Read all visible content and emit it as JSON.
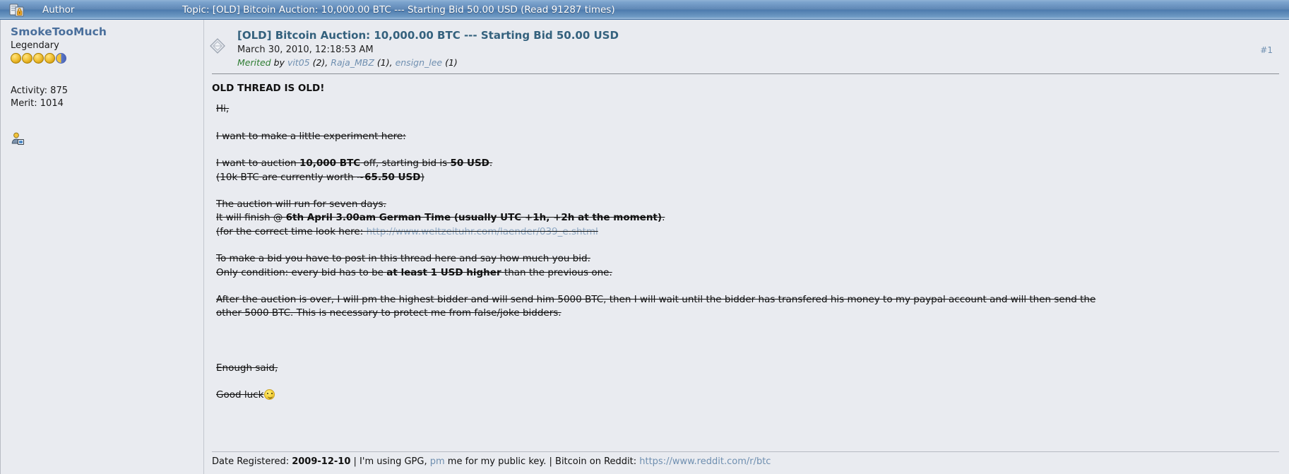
{
  "topbar": {
    "lock_icon": "locked-topic-icon",
    "author_column_label": "Author",
    "topic_label": "Topic: [OLD] Bitcoin Auction: 10,000.00 BTC --- Starting Bid 50.00 USD  (Read 91287 times)"
  },
  "poster": {
    "username": "SmokeTooMuch",
    "rank": "Legendary",
    "badge_count": 5,
    "activity": "Activity: 875",
    "merit": "Merit: 1014",
    "profile_icon": "user-profile-icon"
  },
  "post": {
    "icon": "post-xx-icon",
    "subject": "[OLD] Bitcoin Auction: 10,000.00 BTC --- Starting Bid 50.00 USD",
    "date": "March 30, 2010, 12:18:53 AM",
    "merit": {
      "merited_word": "Merited",
      "by_word": "by",
      "sources": [
        {
          "name": "vit05",
          "count": "(2)"
        },
        {
          "name": "Raja_MBZ",
          "count": "(1)"
        },
        {
          "name": "ensign_lee",
          "count": "(1)"
        }
      ],
      "separator": ", "
    },
    "post_number": "#1",
    "body": {
      "headline": "OLD THREAD IS OLD!",
      "greeting": "Hi,",
      "line_experiment": "I want to make a little experiment here:",
      "auction_pre": "I want to auction ",
      "auction_amount": "10,000 BTC",
      "auction_mid": " off, starting bid is ",
      "auction_bid": "50 USD",
      "auction_post": ".",
      "worth_pre": "(10k BTC are currently worth ~",
      "worth_value": "65.50 USD",
      "worth_post": ")",
      "run_days": "The auction will run for seven days.",
      "finish_pre": "It will finish @ ",
      "finish_bold": "6th April 3.00am German Time (usually UTC +1h, +2h at the moment)",
      "finish_post": ".",
      "timelink_pre": "(for the correct time look here: ",
      "timelink_url": "http://www.weltzeituhr.com/laender/039_e.shtml",
      "bid_howto": "To make a bid you have to post in this thread here and say how much you bid.",
      "condition_pre": "Only condition: every bid has to be ",
      "condition_bold": "at least 1 USD higher",
      "condition_post": " than the previous one.",
      "after_auction_line1": "After the auction is over, I will pm the highest bidder and will send him 5000 BTC, then I will wait until the bidder has transfered his money to my paypal account and will then send the",
      "after_auction_line2": "other 5000 BTC. This is necessary to protect me from false/joke bidders.",
      "enough_said": "Enough said,",
      "good_luck": "Good luck",
      "good_luck_smiley": "smiley-wink-icon"
    }
  },
  "signature": {
    "date_registered_label": "Date Registered: ",
    "date_registered_value": "2009-12-10",
    "sep1": " | ",
    "gpg_pre": "I'm using GPG, ",
    "pm_link": "pm",
    "gpg_post": " me for my public key.",
    "sep2": " | ",
    "reddit_label": "Bitcoin on Reddit: ",
    "reddit_url": "https://www.reddit.com/r/btc"
  },
  "colors": {
    "topbar_blue": "#5e86b4",
    "page_bg": "#e9ebf0",
    "link_blue": "#6f8fb0",
    "subject_blue": "#34617d",
    "username_blue": "#4a6f9c",
    "merit_green": "#2e7d32"
  }
}
